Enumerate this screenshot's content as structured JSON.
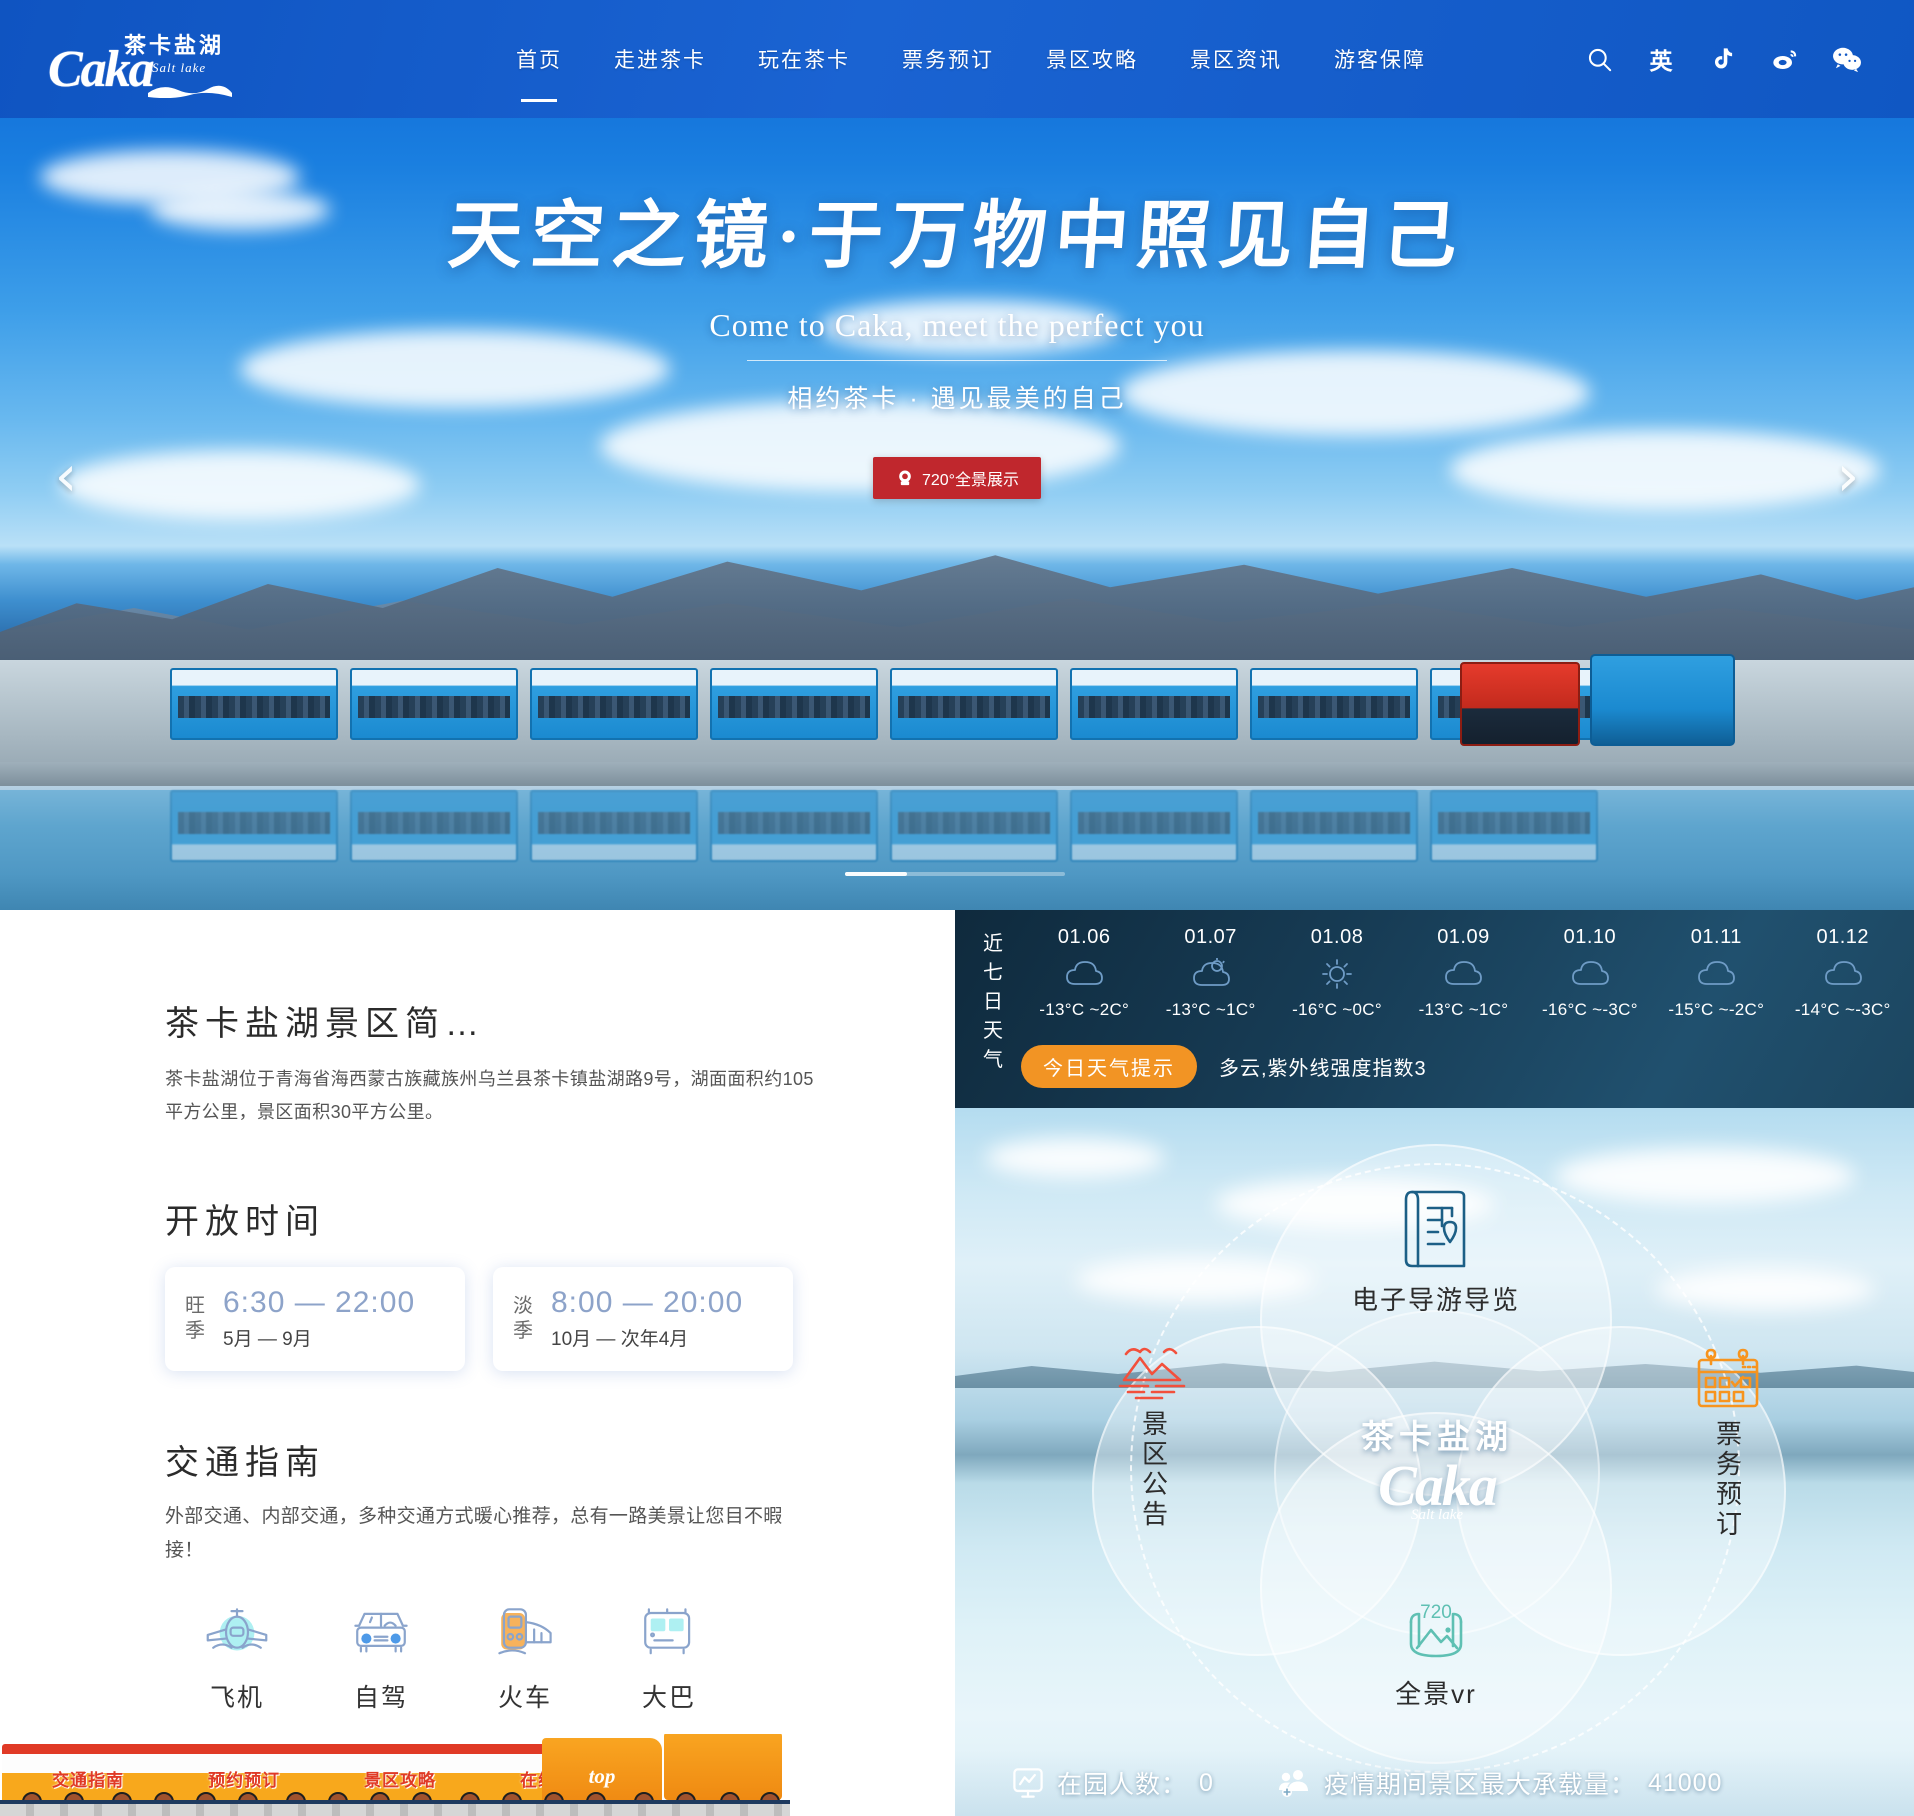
{
  "header": {
    "logo": {
      "cn": "茶卡盐湖",
      "brand": "Caka",
      "en": "Salt lake"
    },
    "nav": [
      {
        "label": "首页",
        "active": true
      },
      {
        "label": "走进茶卡",
        "active": false
      },
      {
        "label": "玩在茶卡",
        "active": false
      },
      {
        "label": "票务预订",
        "active": false
      },
      {
        "label": "景区攻略",
        "active": false
      },
      {
        "label": "景区资讯",
        "active": false
      },
      {
        "label": "游客保障",
        "active": false
      }
    ],
    "icons": [
      {
        "name": "search-icon",
        "label": ""
      },
      {
        "name": "language-icon",
        "label": "英"
      },
      {
        "name": "douyin-icon",
        "label": ""
      },
      {
        "name": "weibo-icon",
        "label": ""
      },
      {
        "name": "wechat-icon",
        "label": ""
      }
    ]
  },
  "hero": {
    "title": "天空之镜·于万物中照见自己",
    "subtitle_en": "Come to Caka, meet the perfect you",
    "subtitle_cn": "相约茶卡 · 遇见最美的自己",
    "vr_button": "720°全景展示",
    "prev_arrow": "‹",
    "next_arrow": "›"
  },
  "intro": {
    "title": "茶卡盐湖景区简…",
    "description": "茶卡盐湖位于青海省海西蒙古族藏族州乌兰县茶卡镇盐湖路9号，湖面面积约105平方公里，景区面积30平方公里。"
  },
  "hours": {
    "title": "开放时间",
    "cards": [
      {
        "season": "旺季",
        "time": "6:30 — 22:00",
        "months": "5月 — 9月"
      },
      {
        "season": "淡季",
        "time": "8:00 — 20:00",
        "months": "10月 — 次年4月"
      }
    ]
  },
  "traffic": {
    "title": "交通指南",
    "description": "外部交通、内部交通，多种交通方式暖心推荐，总有一路美景让您目不暇接！",
    "modes": [
      {
        "label": "飞机",
        "icon": "plane-icon"
      },
      {
        "label": "自驾",
        "icon": "car-icon"
      },
      {
        "label": "火车",
        "icon": "train-icon"
      },
      {
        "label": "大巴",
        "icon": "bus-icon"
      }
    ]
  },
  "train_nav": {
    "items": [
      "交通指南",
      "预约预订",
      "景区攻略",
      "在线咨询"
    ],
    "top_label": "top"
  },
  "weather": {
    "side_label": "近七日天气",
    "days": [
      {
        "date": "01.06",
        "icon": "cloudy",
        "temp": "-13°C ~2C°"
      },
      {
        "date": "01.07",
        "icon": "partly-cloudy",
        "temp": "-13°C ~1C°"
      },
      {
        "date": "01.08",
        "icon": "sunny",
        "temp": "-16°C ~0C°"
      },
      {
        "date": "01.09",
        "icon": "cloudy",
        "temp": "-13°C ~1C°"
      },
      {
        "date": "01.10",
        "icon": "cloudy",
        "temp": "-16°C ~-3C°"
      },
      {
        "date": "01.11",
        "icon": "cloudy",
        "temp": "-15°C ~-2C°"
      },
      {
        "date": "01.12",
        "icon": "cloudy",
        "temp": "-14°C ~-3C°"
      }
    ],
    "tip_button": "今日天气提示",
    "tip_text": "多云,紫外线强度指数3"
  },
  "circle_menu": {
    "center": {
      "cn": "茶卡盐湖",
      "brand": "Caka",
      "en": "Salt lake"
    },
    "items": [
      {
        "label": "电子导游导览",
        "icon": "map-guide-icon",
        "color": "#1c5f86"
      },
      {
        "label": "景区公告",
        "icon": "landscape-notice-icon",
        "color": "#f2503c"
      },
      {
        "label": "票务预订",
        "icon": "calendar-ticket-icon",
        "color": "#f7941e"
      },
      {
        "label": "全景vr",
        "icon": "vr-720-icon",
        "color": "#5fc0b3"
      }
    ]
  },
  "status": {
    "visitors_label": "在园人数：",
    "visitors_value": "0",
    "capacity_label": "疫情期间景区最大承载量：",
    "capacity_value": "41000"
  },
  "colors": {
    "brand_blue": "#1157c4",
    "accent_red": "#c0272d",
    "accent_orange": "#f29424",
    "weather_bg": "#173c55"
  }
}
